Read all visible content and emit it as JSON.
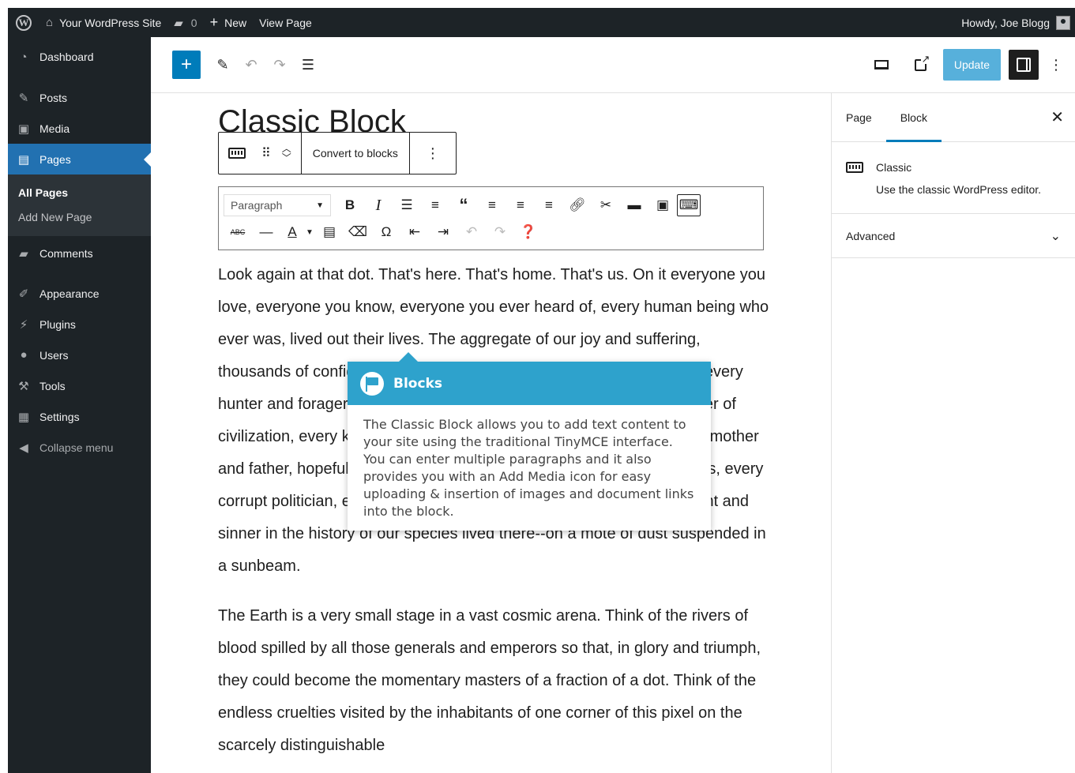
{
  "adminbar": {
    "site_name": "Your WordPress Site",
    "comment_count": "0",
    "new_label": "New",
    "view_page": "View Page",
    "howdy": "Howdy, Joe Blogg"
  },
  "sidebar": {
    "items": [
      {
        "label": "Dashboard",
        "icon": "dashboard-icon"
      },
      {
        "label": "Posts",
        "icon": "pin-icon"
      },
      {
        "label": "Media",
        "icon": "media-icon"
      },
      {
        "label": "Pages",
        "icon": "page-icon"
      },
      {
        "label": "Comments",
        "icon": "comment-icon"
      },
      {
        "label": "Appearance",
        "icon": "brush-icon"
      },
      {
        "label": "Plugins",
        "icon": "plug-icon"
      },
      {
        "label": "Users",
        "icon": "user-icon"
      },
      {
        "label": "Tools",
        "icon": "wrench-icon"
      },
      {
        "label": "Settings",
        "icon": "settings-icon"
      }
    ],
    "submenu": {
      "all_pages": "All Pages",
      "add_new": "Add New Page"
    },
    "collapse": "Collapse menu"
  },
  "header": {
    "update": "Update"
  },
  "editor": {
    "title": "Classic Block",
    "convert": "Convert to blocks",
    "format_select": "Paragraph",
    "paragraphs": [
      "Look again at that dot. That's here. That's home. That's us. On it everyone you love, everyone you know, everyone you ever heard of, every human being who ever was, lived out their lives. The aggregate of our joy and suffering, thousands of confident religions, ideologies, and economic doctrines, every hunter and forager, every hero and coward, every creator and destroyer of civilization, every king and peasant, every young couple in love, every mother and father, hopeful child, inventor and explorer, every teacher of morals, every corrupt politician, every \"superstar,\" every \"supreme leader,\" every saint and sinner in the history of our species lived there--on a mote of dust suspended in a sunbeam.",
      "The Earth is a very small stage in a vast cosmic arena. Think of the rivers of blood spilled by all those generals and emperors so that, in glory and triumph, they could become the momentary masters of a fraction of a dot. Think of the endless cruelties visited by the inhabitants of one corner of this pixel on the scarcely distinguishable"
    ]
  },
  "tooltip": {
    "title": "Blocks",
    "body": "The Classic Block allows you to add text content to your site using the traditional TinyMCE interface. You can enter multiple paragraphs and it also provides you with an Add Media icon for easy uploading & insertion of images and document links into the block."
  },
  "settings": {
    "tab_page": "Page",
    "tab_block": "Block",
    "block_name": "Classic",
    "block_desc": "Use the classic WordPress editor.",
    "advanced": "Advanced"
  },
  "colors": {
    "admin_bg": "#1d2327",
    "accent": "#007cba",
    "active_menu": "#2271b1",
    "tooltip": "#2ea2cc"
  }
}
